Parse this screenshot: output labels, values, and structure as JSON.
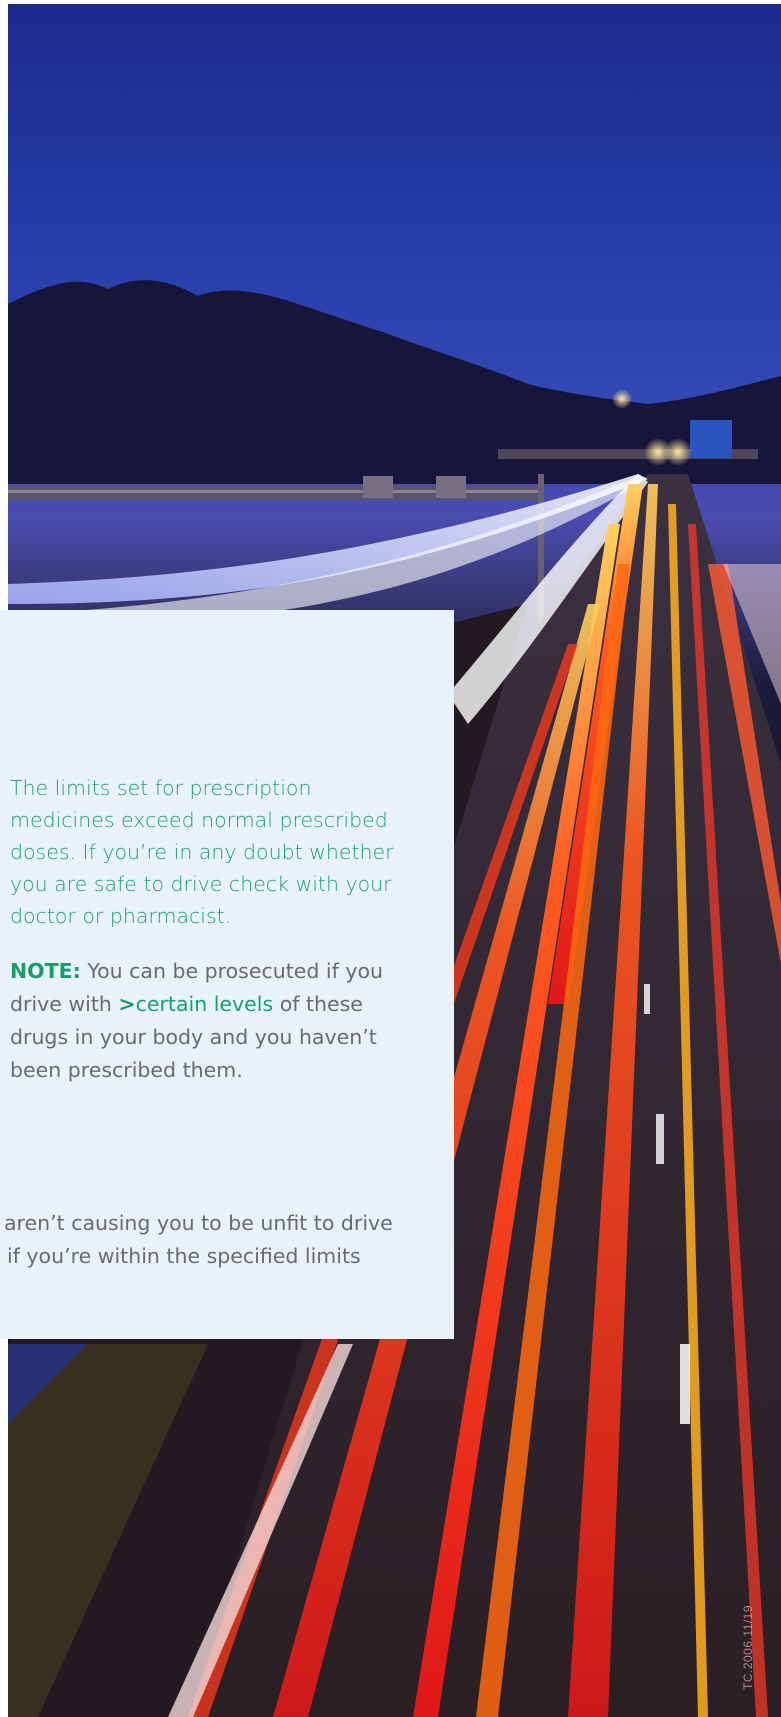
{
  "photo": {
    "icon": "motorway-night-traffic-image"
  },
  "info_panel": {
    "paragraph": "The limits set for prescription medicines exceed normal prescribed doses. If you’re in any doubt whether you are safe to drive check with your doctor or pharmacist.",
    "note": {
      "label": "NOTE:",
      "text_before": "You can be prosecuted if you drive with",
      "arrow": ">",
      "link_text": "certain levels",
      "text_after": "of these drugs in your body and you haven’t been prescribed them."
    },
    "partial_lines": [
      "aren’t causing you to be unfit to drive",
      "if you’re within the specified limits"
    ]
  },
  "document_code": "TC.2006.11/19",
  "colors": {
    "accent_green": "#1aa06d",
    "panel_background": "#eaf2f9",
    "body_text": "#6b6b6b"
  }
}
